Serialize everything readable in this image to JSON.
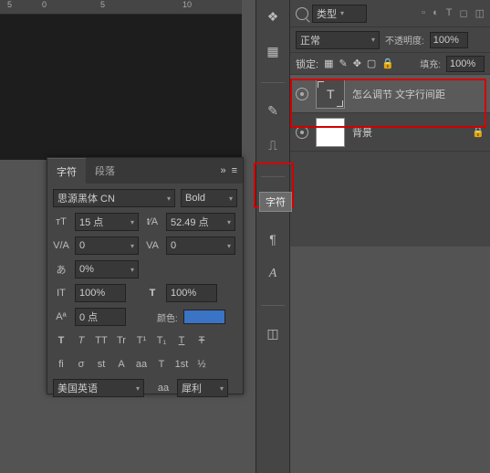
{
  "ruler": {
    "marks": [
      "5",
      "0",
      "5",
      "10"
    ]
  },
  "layers_panel": {
    "filter_label": "类型",
    "blend_mode": "正常",
    "opacity_label": "不透明度:",
    "opacity_value": "100%",
    "lock_label": "锁定:",
    "fill_label": "填充:",
    "fill_value": "100%",
    "layers": [
      {
        "name": "怎么调节 文字行间距",
        "type": "text",
        "selected": true
      },
      {
        "name": "背景",
        "type": "bg",
        "locked": true
      }
    ]
  },
  "tooltip": "字符",
  "char_panel": {
    "tabs": {
      "char": "字符",
      "para": "段落"
    },
    "menu_glyph": "»",
    "font_family": "思源黑体 CN",
    "font_style": "Bold",
    "font_size": "15 点",
    "leading": "52.49 点",
    "va": "0",
    "tracking": "0",
    "scale_pct": "0%",
    "h_scale": "100%",
    "v_scale": "100%",
    "baseline": "0 点",
    "color_label": "颜色:",
    "color_value": "#3b74c4",
    "style_row1": [
      "T",
      "T",
      "TT",
      "Tr",
      "T¹",
      "T₁",
      "T",
      "Ŧ"
    ],
    "style_row2": [
      "fi",
      "σ",
      "st",
      "A",
      "aa",
      "T",
      "1st",
      "½"
    ],
    "language": "美国英语",
    "aa_glyph": "aa",
    "antialias": "犀利"
  }
}
